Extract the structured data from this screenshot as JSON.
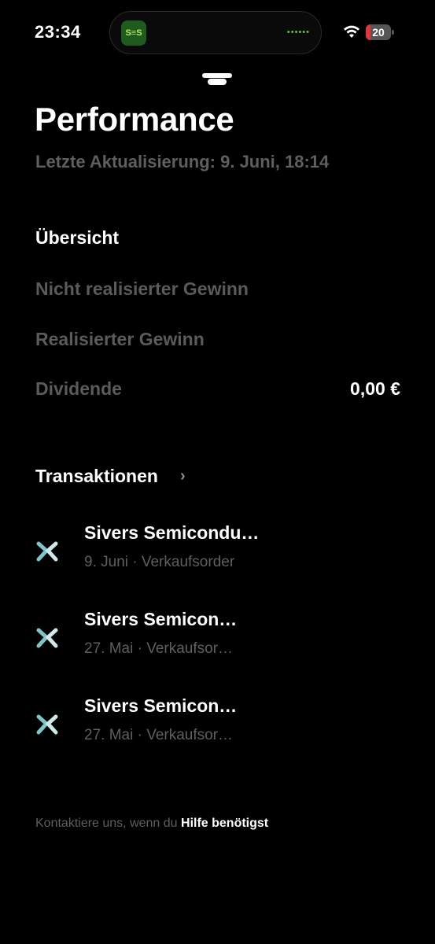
{
  "status_bar": {
    "time": "23:34",
    "app_badge": "S≡S",
    "battery_level": "20",
    "battery_fraction": 0.2
  },
  "header": {
    "title": "Performance",
    "subtitle": "Letzte Aktualisierung: 9. Juni, 18:14"
  },
  "overview": {
    "title": "Übersicht",
    "rows": [
      {
        "label": "Nicht realisierter Gewinn",
        "value": ""
      },
      {
        "label": "Realisierter Gewinn",
        "value": ""
      },
      {
        "label": "Dividende",
        "value": "0,00 €"
      }
    ]
  },
  "transactions": {
    "title": "Transaktionen",
    "items": [
      {
        "name": "Sivers Semicondu…",
        "meta": "9. Juni · Verkaufsorder",
        "amount": ""
      },
      {
        "name": "Sivers Semicon…",
        "meta": "27. Mai · Verkaufsor…",
        "amount": ""
      },
      {
        "name": "Sivers Semicon…",
        "meta": "27. Mai · Verkaufsor…",
        "amount": ""
      }
    ]
  },
  "footer": {
    "text": "Kontaktiere uns, wenn du ",
    "link": "Hilfe benötigst"
  },
  "colors": {
    "background": "#000000",
    "muted": "#5e5e63",
    "icon_teal": "#7ec4c8",
    "battery_red": "#e5343a"
  }
}
